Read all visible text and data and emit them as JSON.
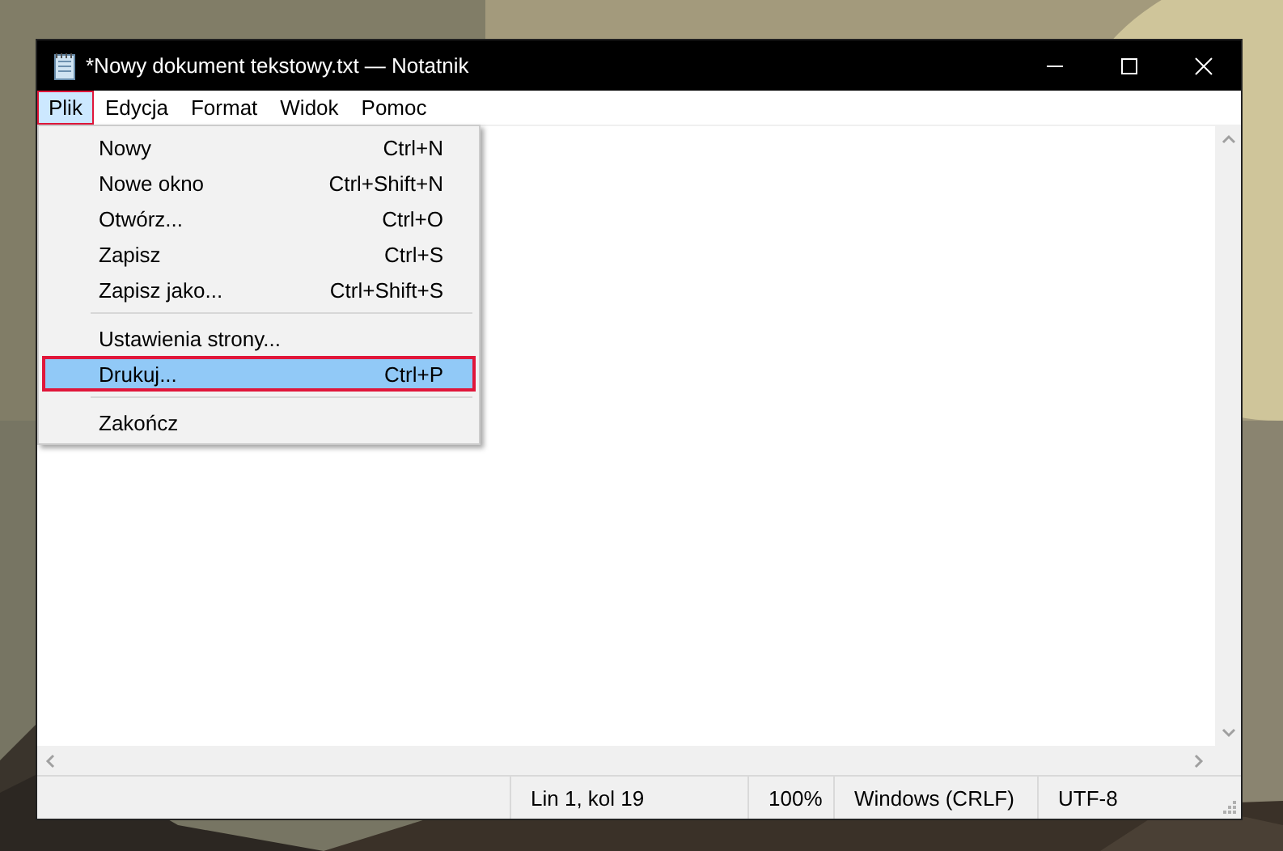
{
  "window": {
    "title": "*Nowy dokument tekstowy.txt — Notatnik"
  },
  "menu_bar": [
    {
      "label": "Plik",
      "selected": true
    },
    {
      "label": "Edycja",
      "selected": false
    },
    {
      "label": "Format",
      "selected": false
    },
    {
      "label": "Widok",
      "selected": false
    },
    {
      "label": "Pomoc",
      "selected": false
    }
  ],
  "menu": [
    {
      "kind": "item",
      "label": "Nowy",
      "shortcut": "Ctrl+N",
      "selected": false
    },
    {
      "kind": "item",
      "label": "Nowe okno",
      "shortcut": "Ctrl+Shift+N",
      "selected": false
    },
    {
      "kind": "item",
      "label": "Otwórz...",
      "shortcut": "Ctrl+O",
      "selected": false
    },
    {
      "kind": "item",
      "label": "Zapisz",
      "shortcut": "Ctrl+S",
      "selected": false
    },
    {
      "kind": "item",
      "label": "Zapisz jako...",
      "shortcut": "Ctrl+Shift+S",
      "selected": false
    },
    {
      "kind": "separator"
    },
    {
      "kind": "item",
      "label": "Ustawienia strony...",
      "selected": false
    },
    {
      "kind": "item",
      "label": "Drukuj...",
      "shortcut": "Ctrl+P",
      "selected": true
    },
    {
      "kind": "separator"
    },
    {
      "kind": "item",
      "label": "Zakończ",
      "selected": false
    }
  ],
  "status_bar": [
    "Lin 1, kol 19",
    "100%",
    "Windows (CRLF)",
    "UTF-8"
  ]
}
